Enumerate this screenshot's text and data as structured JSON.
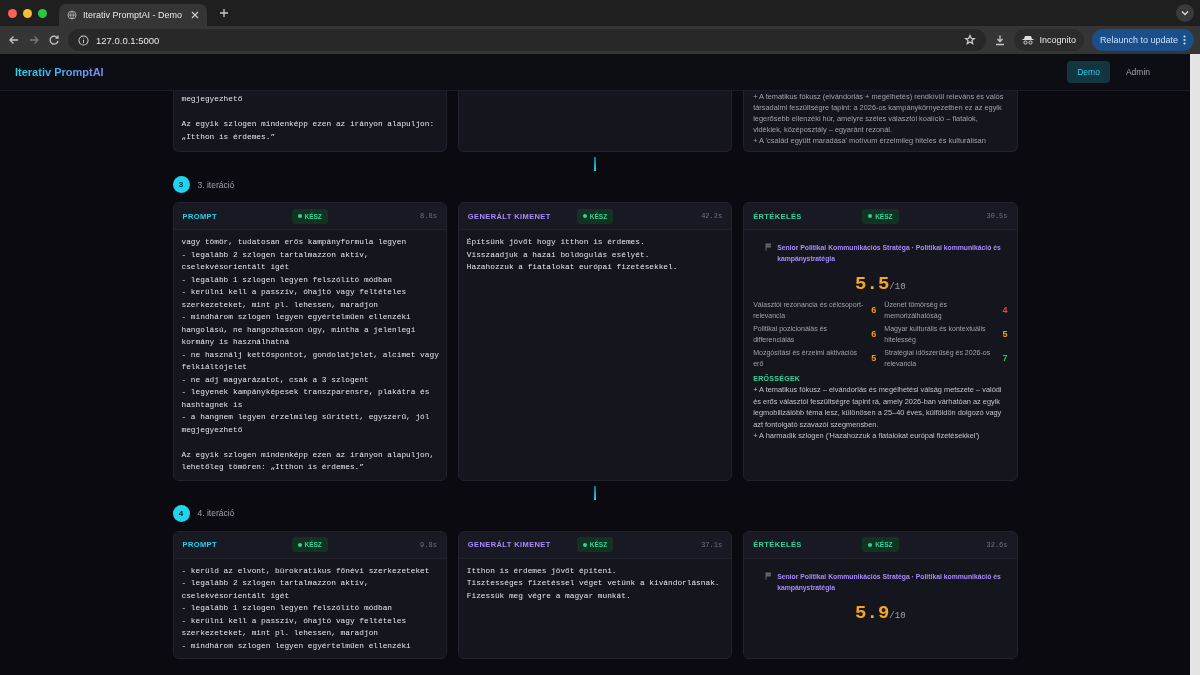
{
  "browser": {
    "tab_title": "Iterativ PromptAI - Demo",
    "url": "127.0.0.1:5000",
    "profile": "Incognito",
    "update_button": "Relaunch to update"
  },
  "app": {
    "brand": "Iterativ PromptAI",
    "nav": [
      {
        "label": "Demo",
        "selected": true
      },
      {
        "label": "Admin",
        "selected": false
      }
    ]
  },
  "previous_tail": {
    "prompt_paragraphs": [
      [
        "megjegyezhető"
      ],
      [
        "Az egyik szlogen mindenképp ezen az irányon alapuljon:",
        "„Itthon is érdemes.”"
      ]
    ],
    "evaluation_text": [
      "+ A tematikus fókusz (elvándorlás + megélhetés) rendkívül releváns és valós társadalmi feszültségre tapint: a 2026-os kampánykörnyezetben ez az egyik legerősebb ellenzéki húr, amelyre széles választói koalíció – fiatalok, vidékiek, középosztály – egyaránt rezonál.",
      "+ A 'család együtt maradása' motívum érzelmileg hiteles és kulturálisan"
    ]
  },
  "iterations": [
    {
      "number": "3",
      "label": "3. iteráció",
      "cards": [
        {
          "kind": "prompt",
          "title": "PROMPT",
          "status": "KÉSZ",
          "time": "8.8s",
          "paragraphs": [
            [
              "vagy tömör, tudatosan erős kampányformula legyen",
              "- legalább 2 szlogen tartalmazzon aktív,",
              "cselekvésorientált igét",
              "- legalább 1 szlogen legyen felszólító módban",
              "- kerülni kell a passzív, óhajtó vagy feltételes",
              "szerkezeteket, mint pl. lehessen, maradjon",
              "- mindhárom szlogen legyen egyértelműen ellenzéki",
              "hangolású, ne hangozhasson úgy, mintha a jelenlegi",
              "kormány is használhatná",
              "- ne használj kettőspontot, gondolatjelet, alcímet vagy",
              "felkiáltójelet",
              "- ne adj magyarázatot, csak a 3 szlogent",
              "- legyenek kampányképesek transzparensre, plakátra és",
              "hashtagnek is",
              "- a hangnem legyen érzelmileg sűrített, egyszerű, jól",
              "megjegyezhető"
            ],
            [
              "Az egyik szlogen mindenképp ezen az irányon alapuljon,",
              "lehetőleg tömören: „Itthon is érdemes.”"
            ]
          ]
        },
        {
          "kind": "output",
          "title": "GENERÁLT KIMENET",
          "status": "KÉSZ",
          "time": "42.2s",
          "paragraphs": [
            [
              "Építsünk jövőt hogy itthon is érdemes.",
              "Visszaadjuk a hazai boldogulás esélyét.",
              "Hazahozzuk a fiatalokat európai fizetésekkel."
            ]
          ]
        },
        {
          "kind": "evaluation",
          "title": "ÉRTÉKELÉS",
          "status": "KÉSZ",
          "time": "30.5s",
          "expert": "Senior Politikai Kommunikációs Stratéga · Politikai kommunikáció és kampánystratégia",
          "score": "5.5",
          "score_max": "/10",
          "criteria": [
            {
              "label": "Választói rezonancia és célcsoport-relevancia",
              "score": "6",
              "color": "#f59e0b"
            },
            {
              "label": "Üzenet tömörség és memorizálhatóság",
              "score": "4",
              "color": "#ef4444"
            },
            {
              "label": "Politikai pozicionálás és differenciálás",
              "score": "6",
              "color": "#f59e0b"
            },
            {
              "label": "Magyar kulturális és kontextuális hitelesség",
              "score": "5",
              "color": "#f59e0b"
            },
            {
              "label": "Mozgósítási és érzelmi aktivációs erő",
              "score": "5",
              "color": "#f59e0b"
            },
            {
              "label": "Stratégiai időszerűség és 2026-os relevancia",
              "score": "7",
              "color": "#22c55e"
            }
          ],
          "strengths_title": "ERŐSSÉGEK",
          "strengths": [
            "+ A tematikus fókusz – elvándorlás és megélhetési válság metszete – valódi és erős választói feszültségre tapint rá, amely 2026-ban várhatóan az egyik legmobilizálóbb téma lesz, különösen a 25–40 éves, külföldön dolgozó vagy azt fontolgató szavazói szegmensben.",
            "+ A harmadik szlogen ('Hazahozzuk a fiatalokat európai fizetésekkel')"
          ]
        }
      ]
    },
    {
      "number": "4",
      "label": "4. iteráció",
      "cards": [
        {
          "kind": "prompt",
          "title": "PROMPT",
          "status": "KÉSZ",
          "time": "9.8s",
          "paragraphs": [
            [
              "- kerüld az elvont, bürokratikus főnévi szerkezeteket",
              "- legalább 2 szlogen tartalmazzon aktív,",
              "cselekvésorientált igét",
              "- legalább 1 szlogen legyen felszólító módban",
              "- kerülni kell a passzív, óhajtó vagy feltételes",
              "szerkezeteket, mint pl. lehessen, maradjon",
              "- mindhárom szlogen legyen egyértelműen ellenzéki"
            ]
          ]
        },
        {
          "kind": "output",
          "title": "GENERÁLT KIMENET",
          "status": "KÉSZ",
          "time": "37.1s",
          "paragraphs": [
            [
              "Itthon is érdemes jövőt építeni.",
              "Tisztességes fizetéssel véget vetünk a kivándorlásnak.",
              "Fizessük meg végre a magyar munkát."
            ]
          ]
        },
        {
          "kind": "evaluation",
          "title": "ÉRTÉKELÉS",
          "status": "KÉSZ",
          "time": "32.6s",
          "expert": "Senior Politikai Kommunikációs Stratéga · Politikai kommunikáció és kampánystratégia",
          "score": "5.9",
          "score_max": "/10"
        }
      ]
    }
  ]
}
